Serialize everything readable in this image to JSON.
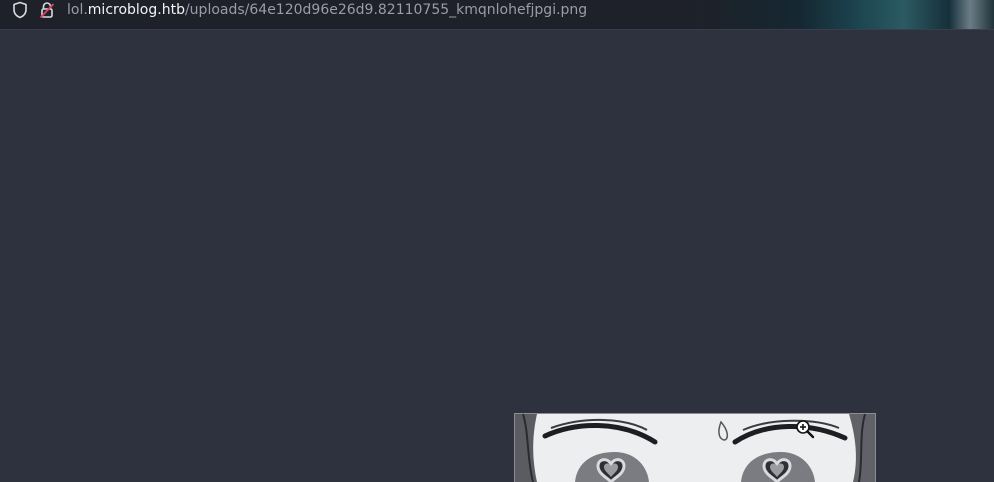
{
  "urlbar": {
    "url_prefix": "lol.",
    "url_domain": "microblog.htb",
    "url_path": "/uploads/64e120d96e26d9.82110755_kmqnlohefjpgi.png"
  },
  "icons": {
    "shield": "shield-icon",
    "lock": "insecure-lock-icon",
    "cursor": "zoom-in-cursor-icon"
  },
  "colors": {
    "viewer_background": "#2e313e",
    "urlbar_background": "#1e2129",
    "url_text": "#9a9ca6",
    "url_domain_text": "#f3f3f5",
    "lock_accent": "#e0415e"
  },
  "image": {
    "content": "manga-style eyes with heart-shaped pupils"
  }
}
